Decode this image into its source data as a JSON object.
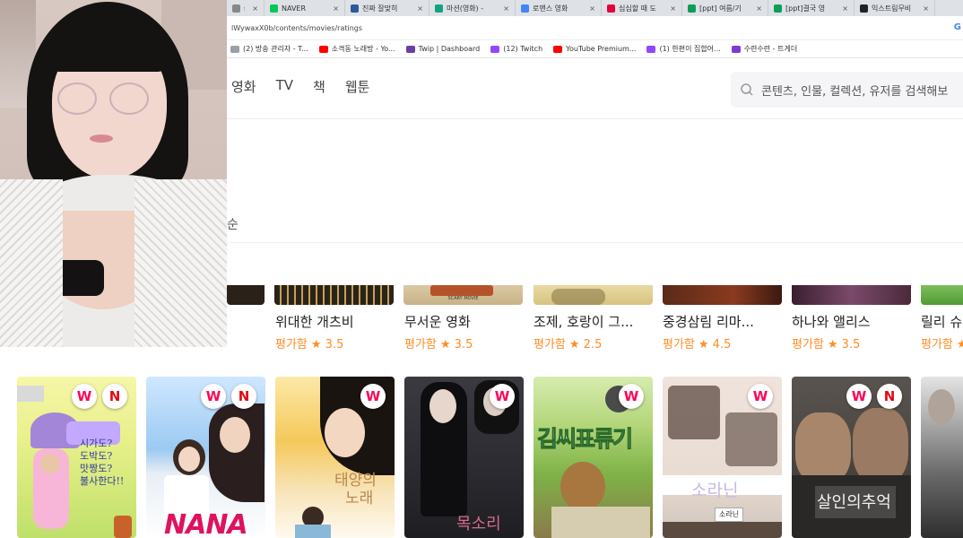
{
  "browser": {
    "tabs": [
      {
        "label": "shi",
        "color": "#888888"
      },
      {
        "label": "NAVER",
        "color": "#03c75a"
      },
      {
        "label": "진짜 잘맞히",
        "color": "#2b5a9a"
      },
      {
        "label": "마션(영화) -",
        "color": "#10a37f"
      },
      {
        "label": "로맨스 영화",
        "color": "#4285f4"
      },
      {
        "label": "심심할 때 도",
        "color": "#e4003a"
      },
      {
        "label": "[ppt] 여름/기",
        "color": "#0f9d58"
      },
      {
        "label": "[ppt]결국 영",
        "color": "#0f9d58"
      },
      {
        "label": "익스트림무비",
        "color": "#222222"
      }
    ],
    "url": "lWywaxX0b/contents/movies/ratings",
    "bookmarks": [
      {
        "label": "(2) 방송 관리자 - T...",
        "color": "#9aa0a6"
      },
      {
        "label": "소격동 노래방 - Yo...",
        "color": "#ff0000"
      },
      {
        "label": "Twip | Dashboard",
        "color": "#6b3fa0"
      },
      {
        "label": "(12) Twitch",
        "color": "#9146ff"
      },
      {
        "label": "YouTube Premium...",
        "color": "#ff0000"
      },
      {
        "label": "(1) 한편이 집합어...",
        "color": "#9146ff"
      },
      {
        "label": "수련수련 - 트게더",
        "color": "#7a3bd6"
      }
    ]
  },
  "header": {
    "nav": [
      "영화",
      "TV",
      "책",
      "웹툰"
    ],
    "search_placeholder": "콘텐츠, 인물, 컬렉션, 유저를 검색해보"
  },
  "sort_label": "순",
  "row1": [
    {
      "title": "위대한 개츠비",
      "rating_label": "평가함",
      "rating": "★ 3.5"
    },
    {
      "title": "무서운 영화",
      "rating_label": "평가함",
      "rating": "★ 3.5"
    },
    {
      "title": "조제, 호랑이 그...",
      "rating_label": "평가함",
      "rating": "★ 2.5"
    },
    {
      "title": "중경삼림 리마...",
      "rating_label": "평가함",
      "rating": "★ 4.5"
    },
    {
      "title": "하나와 앨리스",
      "rating_label": "평가함",
      "rating": "★ 3.5"
    },
    {
      "title": "릴리 슈",
      "rating_label": "평가함",
      "rating": "★"
    }
  ],
  "row1_poster_text": {
    "scary_movie": "SCARY MOVIE"
  },
  "row2": [
    {
      "badges": [
        "W",
        "N"
      ],
      "text": [
        "시가도?",
        "도박도?",
        "맛짱도?",
        "불사한다!!"
      ]
    },
    {
      "badges": [
        "W",
        "N"
      ],
      "text": [
        "NANA"
      ]
    },
    {
      "badges": [
        "W"
      ],
      "text": [
        "태양의",
        "노래"
      ]
    },
    {
      "badges": [
        "W"
      ],
      "text": [
        "목소리"
      ]
    },
    {
      "badges": [
        "W"
      ],
      "text": [
        "김씨표류기"
      ]
    },
    {
      "badges": [
        "W"
      ],
      "text": [
        "소라닌",
        "소라닌"
      ]
    },
    {
      "badges": [
        "W",
        "N"
      ],
      "text": [
        "살인의추억"
      ]
    },
    {
      "badges": [],
      "text": []
    }
  ],
  "colors": {
    "watcha": "#ff0558",
    "netflix": "#e50914",
    "rating": "#ff8d24"
  }
}
